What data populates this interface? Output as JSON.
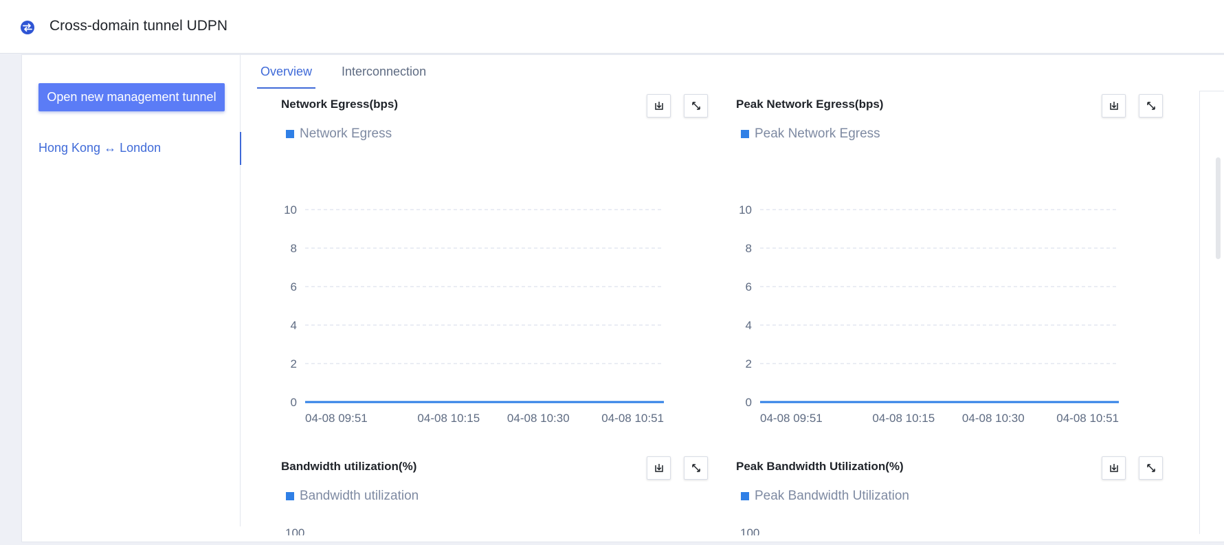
{
  "header": {
    "title": "Cross-domain tunnel UDPN",
    "logo_icon": "swap-arrows-icon",
    "accent": "#3f6ad8"
  },
  "sidebar": {
    "primary_button": "Open new management tunnel",
    "tunnels": [
      {
        "label": "Hong Kong ↔ London",
        "active": true
      }
    ]
  },
  "tabs": [
    {
      "label": "Overview",
      "active": true
    },
    {
      "label": "Interconnection",
      "active": false
    }
  ],
  "toolbar_icons": {
    "download": "download-icon",
    "expand": "expand-icon"
  },
  "chart_data": [
    {
      "type": "line",
      "title": "Network Egress(bps)",
      "series": [
        {
          "name": "Network Egress",
          "values": [
            0,
            0,
            0,
            0
          ]
        }
      ],
      "x": [
        "04-08 09:51",
        "04-08 10:15",
        "04-08 10:30",
        "04-08 10:51"
      ],
      "x_range": [
        "2024-04-08 09:51",
        "2024-04-08 10:51"
      ],
      "yticks": [
        "0",
        "2",
        "4",
        "6",
        "8",
        "10"
      ],
      "ylim": [
        0,
        10
      ],
      "grid": true,
      "legend": "top-left",
      "color": "#2f7fe6"
    },
    {
      "type": "line",
      "title": "Peak Network Egress(bps)",
      "series": [
        {
          "name": "Peak Network Egress",
          "values": [
            0,
            0,
            0,
            0
          ]
        }
      ],
      "x": [
        "04-08 09:51",
        "04-08 10:15",
        "04-08 10:30",
        "04-08 10:51"
      ],
      "x_range": [
        "2024-04-08 09:51",
        "2024-04-08 10:51"
      ],
      "yticks": [
        "0",
        "2",
        "4",
        "6",
        "8",
        "10"
      ],
      "ylim": [
        0,
        10
      ],
      "grid": true,
      "legend": "top-left",
      "color": "#2f7fe6"
    },
    {
      "type": "line",
      "title": "Bandwidth utilization(%)",
      "series": [
        {
          "name": "Bandwidth utilization",
          "values": []
        }
      ],
      "yticks": [
        "100"
      ],
      "legend": "top-left",
      "color": "#2f7fe6"
    },
    {
      "type": "line",
      "title": "Peak Bandwidth Utilization(%)",
      "series": [
        {
          "name": "Peak Bandwidth Utilization",
          "values": []
        }
      ],
      "yticks": [
        "100"
      ],
      "legend": "top-left",
      "color": "#2f7fe6"
    }
  ]
}
